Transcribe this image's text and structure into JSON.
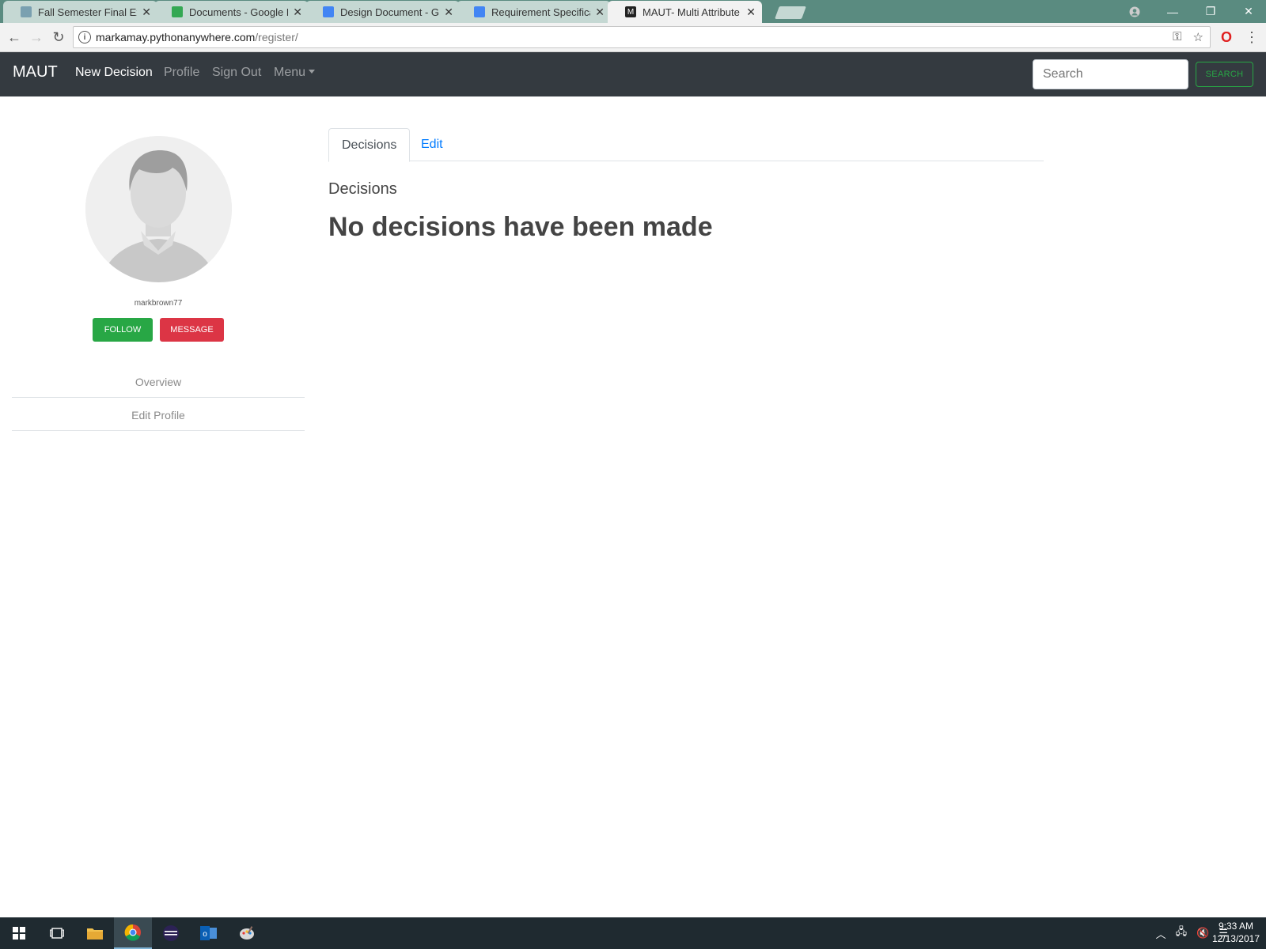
{
  "browser": {
    "tabs": [
      {
        "title": "Fall Semester Final Exam",
        "favicon_color": "#7aa0b0"
      },
      {
        "title": "Documents - Google Dri",
        "favicon_color": "#34a853"
      },
      {
        "title": "Design Document - Goo",
        "favicon_color": "#4285f4"
      },
      {
        "title": "Requirement Specificatio",
        "favicon_color": "#4285f4"
      },
      {
        "title": "MAUT- Multi Attribute U",
        "favicon_color": "#222222"
      }
    ],
    "url_host": "markamay.pythonanywhere.com",
    "url_path": "/register/"
  },
  "navbar": {
    "brand": "MAUT",
    "links": [
      "New Decision",
      "Profile",
      "Sign Out",
      "Menu"
    ],
    "search_placeholder": "Search",
    "search_button": "SEARCH"
  },
  "profile": {
    "username": "markbrown77",
    "follow_label": "FOLLOW",
    "message_label": "MESSAGE",
    "side_links": [
      "Overview",
      "Edit Profile"
    ]
  },
  "main": {
    "tabs": [
      "Decisions",
      "Edit"
    ],
    "section_title": "Decisions",
    "empty_message": "No decisions have been made"
  },
  "taskbar": {
    "time": "9:33 AM",
    "date": "12/13/2017"
  }
}
